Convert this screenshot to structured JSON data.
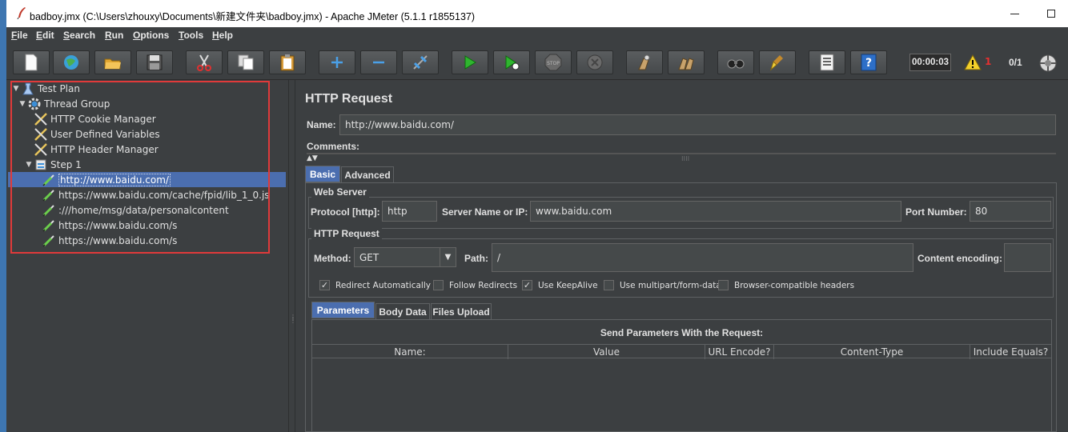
{
  "window": {
    "title": "badboy.jmx (C:\\Users\\zhouxy\\Documents\\新建文件夹\\badboy.jmx) - Apache JMeter (5.1.1 r1855137)"
  },
  "menu": [
    "File",
    "Edit",
    "Search",
    "Run",
    "Options",
    "Tools",
    "Help"
  ],
  "menu_underline": [
    "F",
    "E",
    "S",
    "R",
    "O",
    "T",
    "H"
  ],
  "toolbar": {
    "timer": "00:00:03",
    "warning_count": "1",
    "thread_ratio": "0/1",
    "buttons": [
      "new-icon",
      "templates-icon",
      "open-icon",
      "save-icon",
      "cut-icon",
      "copy-icon",
      "paste-icon",
      "expand-icon",
      "collapse-icon",
      "toggle-icon",
      "start-icon",
      "start-no-pause-icon",
      "stop-icon",
      "shutdown-icon",
      "clear-icon",
      "clear-all-icon",
      "search-icon",
      "reset-search-icon",
      "function-helper-icon",
      "help-icon"
    ]
  },
  "tree": {
    "items": [
      {
        "label": "Test Plan",
        "level": 0,
        "icon": "test-plan-icon",
        "expanded": true
      },
      {
        "label": "Thread Group",
        "level": 1,
        "icon": "gear-icon",
        "expanded": true
      },
      {
        "label": "HTTP Cookie Manager",
        "level": 2,
        "icon": "wrench-icon"
      },
      {
        "label": "User Defined Variables",
        "level": 2,
        "icon": "wrench-icon"
      },
      {
        "label": "HTTP Header Manager",
        "level": 2,
        "icon": "wrench-icon"
      },
      {
        "label": "Step 1",
        "level": 2,
        "icon": "controller-icon",
        "expanded": true
      },
      {
        "label": "http://www.baidu.com/",
        "level": 3,
        "icon": "pipette-icon",
        "selected": true
      },
      {
        "label": "https://www.baidu.com/cache/fpid/lib_1_0.js",
        "level": 3,
        "icon": "pipette-icon"
      },
      {
        "label": ":///home/msg/data/personalcontent",
        "level": 3,
        "icon": "pipette-icon"
      },
      {
        "label": "https://www.baidu.com/s",
        "level": 3,
        "icon": "pipette-icon"
      },
      {
        "label": "https://www.baidu.com/s",
        "level": 3,
        "icon": "pipette-icon"
      }
    ]
  },
  "panel": {
    "title": "HTTP Request",
    "name_label": "Name:",
    "name_value": "http://www.baidu.com/",
    "comments_label": "Comments:",
    "tabs": [
      "Basic",
      "Advanced"
    ],
    "web_server": {
      "legend": "Web Server",
      "protocol_label": "Protocol [http]:",
      "protocol_value": "http",
      "server_label": "Server Name or IP:",
      "server_value": "www.baidu.com",
      "port_label": "Port Number:",
      "port_value": "80"
    },
    "http_request": {
      "legend": "HTTP Request",
      "method_label": "Method:",
      "method_value": "GET",
      "path_label": "Path:",
      "path_value": "/",
      "encoding_label": "Content encoding:",
      "encoding_value": ""
    },
    "checkboxes": [
      {
        "label": "Redirect Automatically",
        "checked": true
      },
      {
        "label": "Follow Redirects",
        "checked": false
      },
      {
        "label": "Use KeepAlive",
        "checked": true
      },
      {
        "label": "Use multipart/form-data",
        "checked": false
      },
      {
        "label": "Browser-compatible headers",
        "checked": false
      }
    ],
    "sub_tabs": [
      "Parameters",
      "Body Data",
      "Files Upload"
    ],
    "params_title": "Send Parameters With the Request:",
    "table_headers": [
      "Name:",
      "Value",
      "URL Encode?",
      "Content-Type",
      "Include Equals?"
    ]
  },
  "colors": {
    "background": "#3c3f41",
    "selection": "#4b6eaf",
    "highlight_box": "#e03a3a"
  }
}
